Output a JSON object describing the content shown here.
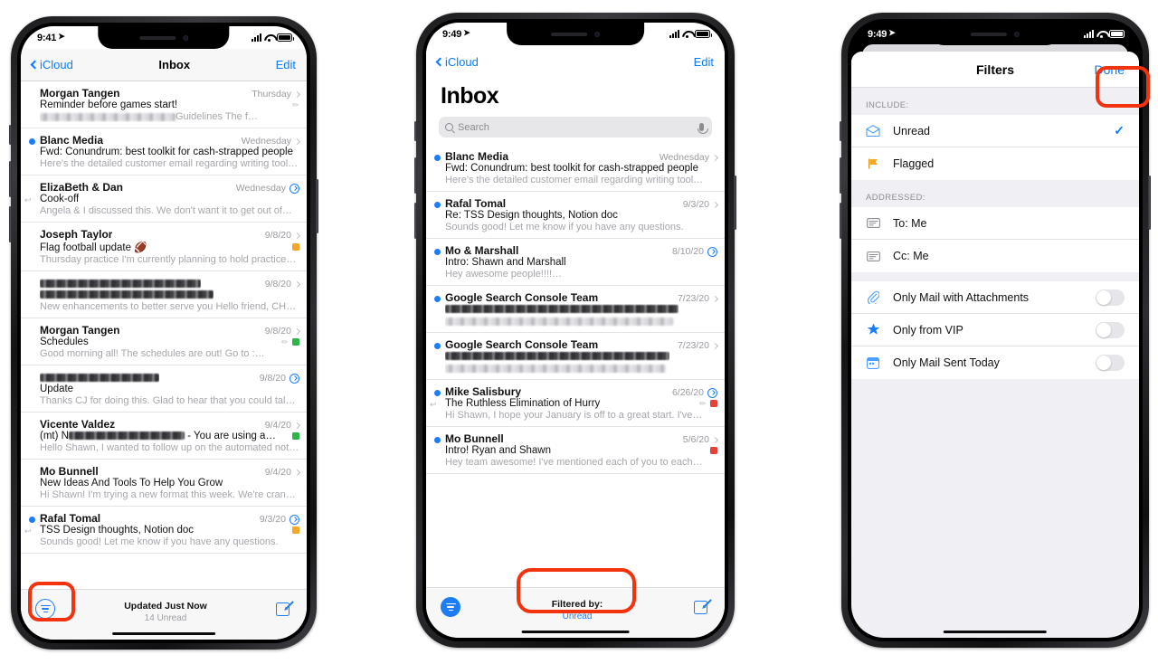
{
  "phones": [
    {
      "id": "inbox-unfiltered",
      "status": {
        "time": "9:41",
        "location_icon": "location-arrow-icon",
        "signal": "cellular-signal-icon",
        "wifi": "wifi-icon",
        "battery": "battery-icon"
      },
      "nav": {
        "back": "iCloud",
        "title": "Inbox",
        "edit": "Edit"
      },
      "emails": [
        {
          "unread": false,
          "sender": "Morgan Tangen",
          "date": "Thursday",
          "accessory": "chevron",
          "subject": "Reminder before games start!",
          "preview_redacted": true,
          "preview_redact_width": 150,
          "preview": "Guidelines The f…",
          "attachment": true
        },
        {
          "unread": true,
          "sender": "Blanc Media",
          "date": "Wednesday",
          "accessory": "chevron",
          "subject": "Fwd: Conundrum: best toolkit for cash-strapped people",
          "preview": "Here's the detailed customer email regarding writing tool…"
        },
        {
          "unread": false,
          "sender": "ElizaBeth & Dan",
          "date": "Wednesday",
          "accessory": "info",
          "subject": "Cook-off",
          "preview": "Angela & I discussed this. We don't want it to get out of…",
          "replied": true
        },
        {
          "unread": false,
          "sender": "Joseph Taylor",
          "date": "9/8/20",
          "accessory": "chevron",
          "subject": "Flag football update 🏈",
          "preview": "Thursday practice I'm currently planning to hold practice…",
          "flag": "orange"
        },
        {
          "unread": false,
          "sender_redacted": true,
          "sender_redact_width": 178,
          "sender": "",
          "date": "9/8/20",
          "accessory": "chevron",
          "subject_redacted": true,
          "subject_redact_width": 192,
          "subject": "",
          "preview": "New enhancements to better serve you Hello friend, CH…"
        },
        {
          "unread": false,
          "sender": "Morgan Tangen",
          "date": "9/8/20",
          "accessory": "chevron",
          "subject": "Schedules",
          "preview": "Good morning all! The schedules are out! Go to :…",
          "flag": "green",
          "attachment": true
        },
        {
          "unread": false,
          "sender_redacted": true,
          "sender_redact_width": 132,
          "sender": "",
          "date": "9/8/20",
          "accessory": "info",
          "subject": "Update",
          "preview": "Thanks CJ for doing this. Glad to hear that you could talk…"
        },
        {
          "unread": false,
          "sender": "Vicente Valdez",
          "date": "9/4/20",
          "accessory": "chevron",
          "subject_prefix": "(mt) N",
          "subject_mid_redacted": true,
          "subject_redact_width": 128,
          "subject": " - You are using a…",
          "preview": "Hello Shawn, I wanted to follow up on the automated noti…",
          "flag": "green"
        },
        {
          "unread": false,
          "sender": "Mo Bunnell",
          "date": "9/4/20",
          "accessory": "chevron",
          "subject": "New Ideas And Tools To Help You Grow",
          "preview": "Hi Shawn! I'm trying a new format this week. We're crank…"
        },
        {
          "unread": true,
          "sender": "Rafal Tomal",
          "date": "9/3/20",
          "accessory": "info",
          "subject": "TSS Design thoughts, Notion doc",
          "preview": "Sounds good! Let me know if you have any questions.",
          "flag": "orange",
          "replied": true
        }
      ],
      "toolbar": {
        "filter_icon": "filter-icon",
        "main": "Updated Just Now",
        "sub": "14 Unread",
        "compose_icon": "compose-icon"
      },
      "highlight": "filter-button"
    },
    {
      "id": "inbox-filtered",
      "status": {
        "time": "9:49",
        "location_icon": "location-arrow-icon",
        "signal": "cellular-signal-icon",
        "wifi": "wifi-icon",
        "battery": "battery-icon"
      },
      "nav": {
        "back": "iCloud",
        "title": "",
        "edit": "Edit"
      },
      "large_title": "Inbox",
      "search": {
        "placeholder": "Search",
        "value": "",
        "icon": "search-icon",
        "mic_icon": "microphone-icon"
      },
      "emails": [
        {
          "unread": true,
          "sender": "Blanc Media",
          "date": "Wednesday",
          "accessory": "chevron",
          "subject": "Fwd: Conundrum: best toolkit for cash-strapped people",
          "preview": "Here's the detailed customer email regarding writing tool…"
        },
        {
          "unread": true,
          "sender": "Rafal Tomal",
          "date": "9/3/20",
          "accessory": "chevron",
          "subject": "Re: TSS Design thoughts, Notion doc",
          "preview": "Sounds good! Let me know if you have any questions."
        },
        {
          "unread": true,
          "sender": "Mo & Marshall",
          "date": "8/10/20",
          "accessory": "info",
          "subject": "Intro: Shawn and Marshall",
          "preview": "Hey awesome people!!!!…"
        },
        {
          "unread": true,
          "sender": "Google Search Console Team",
          "date": "7/23/20",
          "accessory": "chevron",
          "subject_redacted": true,
          "subject_redact_width": 258,
          "subject": "",
          "preview_redacted": true,
          "preview_redact_width": 252,
          "preview": ""
        },
        {
          "unread": true,
          "sender": "Google Search Console Team",
          "date": "7/23/20",
          "accessory": "chevron",
          "subject_redacted": true,
          "subject_redact_width": 248,
          "subject": "",
          "preview_redacted": true,
          "preview_redact_width": 244,
          "preview": ""
        },
        {
          "unread": true,
          "sender": "Mike Salisbury",
          "date": "6/26/20",
          "accessory": "info",
          "subject": "The Ruthless Elimination of Hurry",
          "preview": "Hi Shawn, I hope your January is off to a great start. I've…",
          "flag": "red",
          "replied": true,
          "attachment": true
        },
        {
          "unread": true,
          "sender": "Mo Bunnell",
          "date": "5/6/20",
          "accessory": "chevron",
          "subject": "Intro! Ryan and Shawn",
          "preview": "Hey team awesome! I've mentioned each of you to each…",
          "flag": "red"
        }
      ],
      "toolbar": {
        "filter_icon": "filter-icon",
        "main": "Filtered by:",
        "sub": "Unread",
        "compose_icon": "compose-icon"
      },
      "highlight": "filtered-by-label"
    },
    {
      "id": "filters-sheet",
      "status": {
        "time": "9:49",
        "location_icon": "location-arrow-icon",
        "signal": "cellular-signal-icon",
        "wifi": "wifi-icon",
        "battery": "battery-icon"
      },
      "sheet": {
        "title": "Filters",
        "done": "Done",
        "groups": [
          {
            "header": "INCLUDE:",
            "rows": [
              {
                "icon": "unread-envelope-icon",
                "label": "Unread",
                "accessory": "check",
                "checked": true
              },
              {
                "icon": "flag-icon",
                "label": "Flagged",
                "accessory": "none",
                "checked": false
              }
            ]
          },
          {
            "header": "ADDRESSED:",
            "rows": [
              {
                "icon": "to-card-icon",
                "label": "To: Me",
                "accessory": "none",
                "checked": false
              },
              {
                "icon": "cc-card-icon",
                "label": "Cc: Me",
                "accessory": "none",
                "checked": false
              }
            ]
          },
          {
            "header": "",
            "rows": [
              {
                "icon": "paperclip-icon",
                "label": "Only Mail with Attachments",
                "accessory": "toggle",
                "on": false
              },
              {
                "icon": "star-icon",
                "label": "Only from VIP",
                "accessory": "toggle",
                "on": false
              },
              {
                "icon": "calendar-icon",
                "label": "Only Mail Sent Today",
                "accessory": "toggle",
                "on": false
              }
            ]
          }
        ]
      },
      "highlight": "done-button"
    }
  ],
  "colors": {
    "accent_blue": "#0a7cf7",
    "dot_blue": "#1d7df5",
    "highlight_red": "#f2330d",
    "flag_orange": "#f5a623",
    "flag_green": "#2fb44a",
    "flag_red": "#e8413a",
    "sheet_bg": "#efeff4"
  }
}
